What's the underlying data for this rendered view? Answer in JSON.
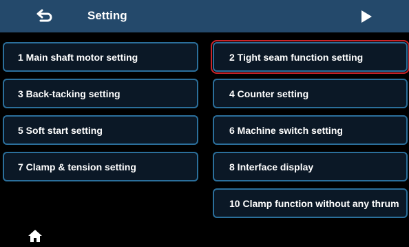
{
  "header": {
    "title": "Setting",
    "back_icon": "back-arrow-icon",
    "next_icon": "play-icon"
  },
  "menu": {
    "items": [
      {
        "label": "1  Main shaft motor setting"
      },
      {
        "label": "2  Tight seam function setting"
      },
      {
        "label": "3  Back-tacking setting"
      },
      {
        "label": "4  Counter setting"
      },
      {
        "label": "5  Soft start setting"
      },
      {
        "label": "6  Machine switch setting"
      },
      {
        "label": "7  Clamp & tension setting"
      },
      {
        "label": "8  Interface display"
      },
      {
        "label": "10 Clamp function without any thrum"
      }
    ],
    "selected_index": 1
  },
  "footer": {
    "home_icon": "home-icon"
  },
  "colors": {
    "header_bg": "#24496b",
    "item_border": "#2b6f9b",
    "selected_outline": "#c8242a",
    "background": "#000000"
  }
}
